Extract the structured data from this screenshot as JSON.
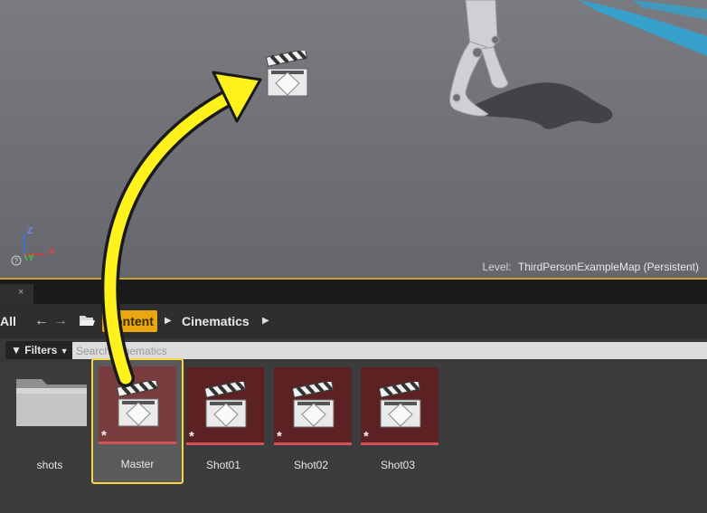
{
  "viewport": {
    "level_label": "Level:",
    "level_name": "ThirdPersonExampleMap (Persistent)",
    "axes": {
      "z": "Z",
      "y": "Y",
      "x": "X"
    },
    "placed_icon": "clapperboard-icon"
  },
  "content_browser": {
    "tab_close": "×",
    "nav": {
      "all_label": "All",
      "back_icon": "←",
      "forward_icon": "→"
    },
    "breadcrumb": [
      {
        "label": "Content"
      },
      {
        "label": "Cinematics"
      }
    ],
    "filters_label": "Filters",
    "search_placeholder": "Search Cinematics",
    "assets": [
      {
        "type": "folder",
        "label": "shots"
      },
      {
        "type": "level-sequence",
        "label": "Master",
        "selected": true,
        "dirty_mark": "*"
      },
      {
        "type": "level-sequence",
        "label": "Shot01",
        "dirty_mark": "*"
      },
      {
        "type": "level-sequence",
        "label": "Shot02",
        "dirty_mark": "*"
      },
      {
        "type": "level-sequence",
        "label": "Shot03",
        "dirty_mark": "*"
      }
    ]
  },
  "colors": {
    "accent": "#e9a812",
    "selection": "#f7d544",
    "sequence_thumb": "#5c2123",
    "sequence_bar": "#d0535a",
    "annotation_arrow": "#fff21c"
  }
}
